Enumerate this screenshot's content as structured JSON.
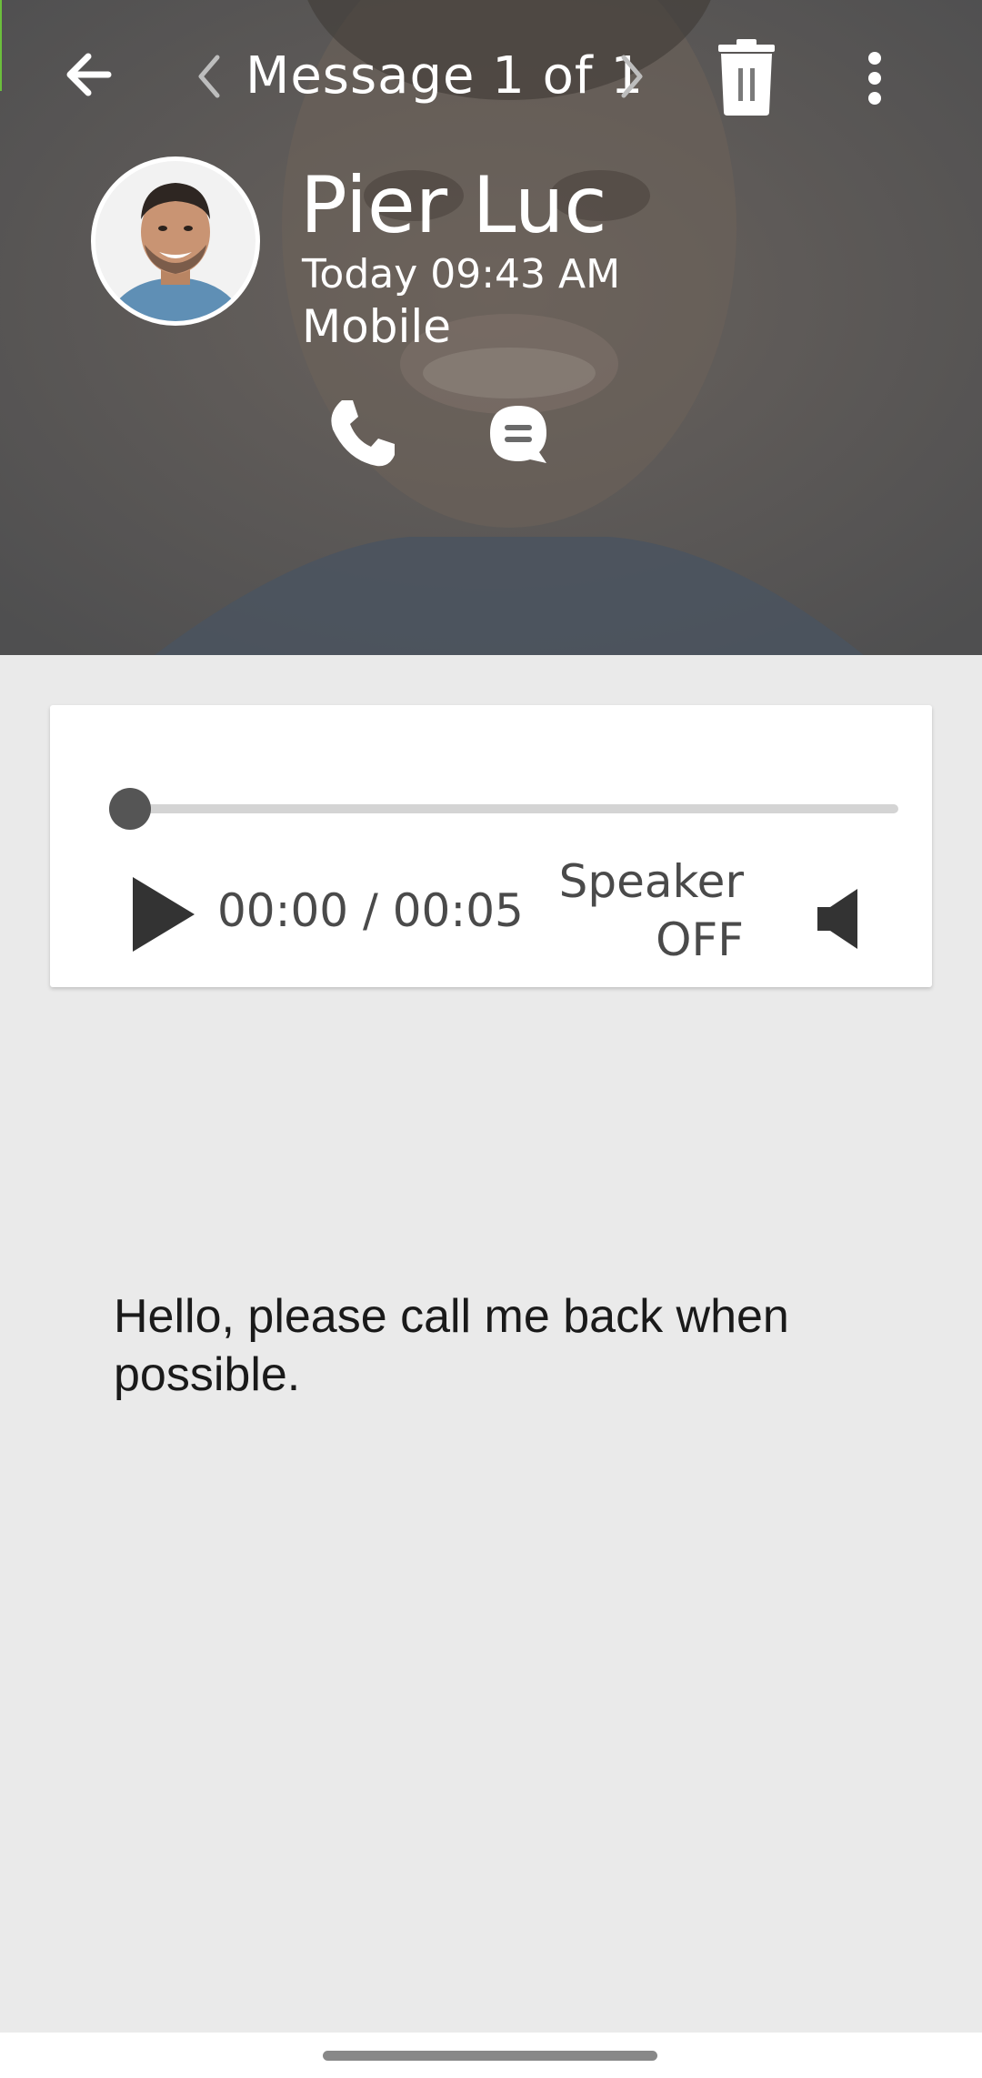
{
  "header": {
    "message_counter": "Message 1 of 1",
    "icons": {
      "back": "arrow-left-icon",
      "previous": "chevron-left-icon",
      "next": "chevron-right-icon",
      "delete": "trash-icon",
      "more": "more-vertical-icon",
      "call": "phone-icon",
      "chat": "chat-bubble-icon"
    }
  },
  "contact": {
    "name": "Pier Luc",
    "time": "Today 09:43 AM",
    "type": "Mobile"
  },
  "player": {
    "time_readout": "00:00 / 00:05",
    "progress_fraction": 0,
    "speaker_line1": "Speaker",
    "speaker_line2": "OFF",
    "icons": {
      "play": "play-icon",
      "speaker": "speaker-icon"
    }
  },
  "transcript": "Hello, please call me back when possible.",
  "colors": {
    "header_overlay": "#5a5a5a",
    "accent_edge": "#6cbf3c",
    "player_control": "#555555",
    "page_background": "#eaeaea"
  }
}
